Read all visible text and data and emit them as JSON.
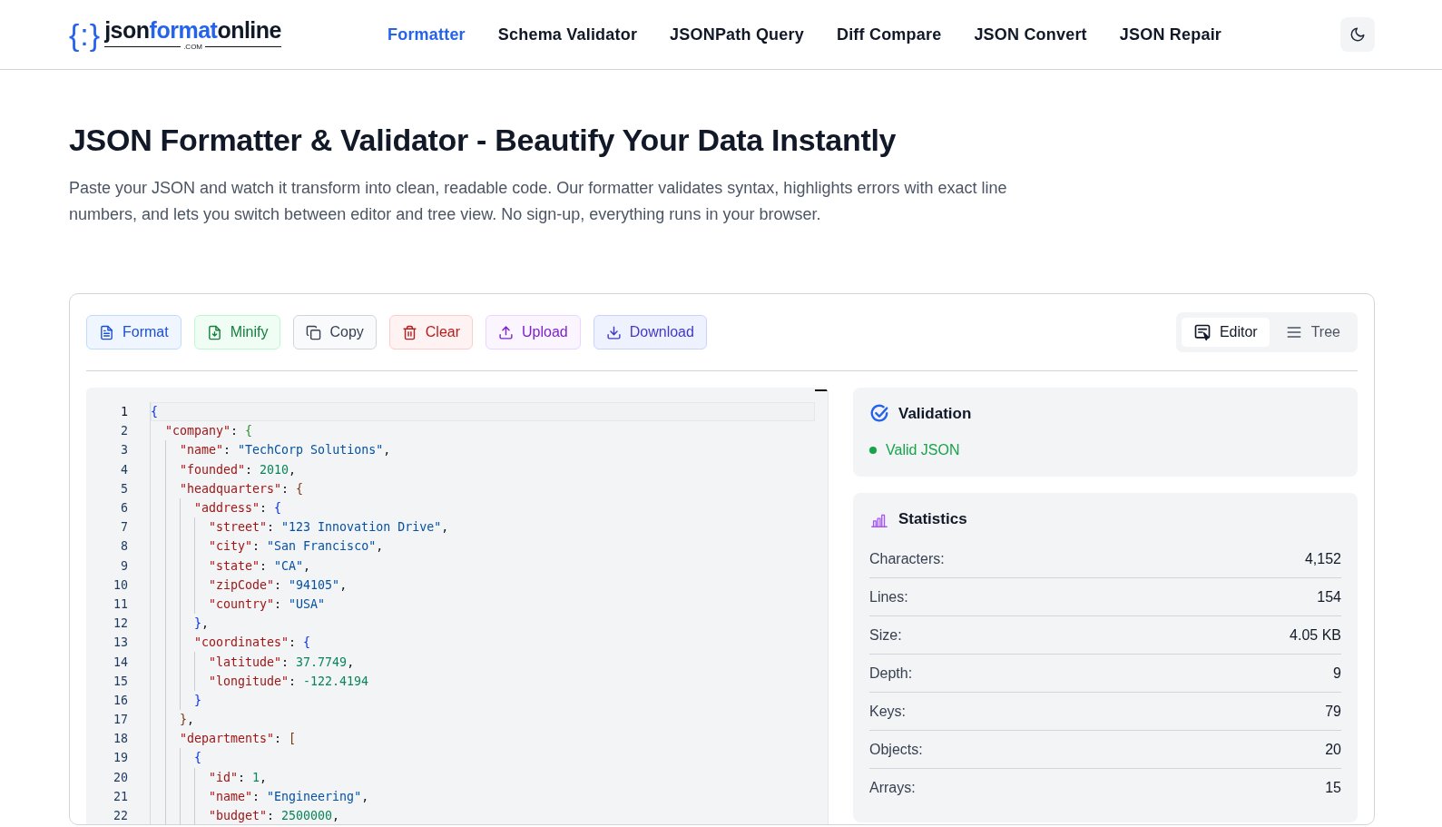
{
  "header": {
    "logo": {
      "mark": "{:}",
      "parts": [
        {
          "text": "json",
          "accent": false
        },
        {
          "text": "format",
          "accent": true
        },
        {
          "text": "online",
          "accent": false
        }
      ],
      "domain": ".COM"
    },
    "nav": [
      {
        "label": "Formatter",
        "selected": true
      },
      {
        "label": "Schema Validator",
        "selected": false
      },
      {
        "label": "JSONPath Query",
        "selected": false
      },
      {
        "label": "Diff Compare",
        "selected": false
      },
      {
        "label": "JSON Convert",
        "selected": false
      },
      {
        "label": "JSON Repair",
        "selected": false
      }
    ]
  },
  "hero": {
    "title": "JSON Formatter & Validator - Beautify Your Data Instantly",
    "description": "Paste your JSON and watch it transform into clean, readable code. Our formatter validates syntax, highlights errors with exact line numbers, and lets you switch between editor and tree view. No sign-up, everything runs in your browser."
  },
  "toolbar": {
    "buttons": [
      {
        "label": "Format",
        "kind": "format"
      },
      {
        "label": "Minify",
        "kind": "minify"
      },
      {
        "label": "Copy",
        "kind": "copy"
      },
      {
        "label": "Clear",
        "kind": "clear"
      },
      {
        "label": "Upload",
        "kind": "upload"
      },
      {
        "label": "Download",
        "kind": "download"
      }
    ],
    "views": [
      {
        "label": "Editor",
        "kind": "editor",
        "selected": true
      },
      {
        "label": "Tree",
        "kind": "tree",
        "selected": false
      }
    ]
  },
  "editor": {
    "lines": [
      {
        "number": "1",
        "active": true,
        "tokens": [
          {
            "text": "{",
            "kind": "brace0"
          }
        ]
      },
      {
        "number": "2",
        "active": false,
        "tokens": [
          {
            "text": "  \"company\"",
            "kind": "key"
          },
          {
            "text": ": ",
            "kind": "punct"
          },
          {
            "text": "{",
            "kind": "brace1"
          }
        ]
      },
      {
        "number": "3",
        "active": false,
        "tokens": [
          {
            "text": "    \"name\"",
            "kind": "key"
          },
          {
            "text": ": ",
            "kind": "punct"
          },
          {
            "text": "\"TechCorp Solutions\"",
            "kind": "string"
          },
          {
            "text": ",",
            "kind": "punct"
          }
        ]
      },
      {
        "number": "4",
        "active": false,
        "tokens": [
          {
            "text": "    \"founded\"",
            "kind": "key"
          },
          {
            "text": ": ",
            "kind": "punct"
          },
          {
            "text": "2010",
            "kind": "number"
          },
          {
            "text": ",",
            "kind": "punct"
          }
        ]
      },
      {
        "number": "5",
        "active": false,
        "tokens": [
          {
            "text": "    \"headquarters\"",
            "kind": "key"
          },
          {
            "text": ": ",
            "kind": "punct"
          },
          {
            "text": "{",
            "kind": "brace2"
          }
        ]
      },
      {
        "number": "6",
        "active": false,
        "tokens": [
          {
            "text": "      \"address\"",
            "kind": "key"
          },
          {
            "text": ": ",
            "kind": "punct"
          },
          {
            "text": "{",
            "kind": "brace0"
          }
        ]
      },
      {
        "number": "7",
        "active": false,
        "tokens": [
          {
            "text": "        \"street\"",
            "kind": "key"
          },
          {
            "text": ": ",
            "kind": "punct"
          },
          {
            "text": "\"123 Innovation Drive\"",
            "kind": "string"
          },
          {
            "text": ",",
            "kind": "punct"
          }
        ]
      },
      {
        "number": "8",
        "active": false,
        "tokens": [
          {
            "text": "        \"city\"",
            "kind": "key"
          },
          {
            "text": ": ",
            "kind": "punct"
          },
          {
            "text": "\"San Francisco\"",
            "kind": "string"
          },
          {
            "text": ",",
            "kind": "punct"
          }
        ]
      },
      {
        "number": "9",
        "active": false,
        "tokens": [
          {
            "text": "        \"state\"",
            "kind": "key"
          },
          {
            "text": ": ",
            "kind": "punct"
          },
          {
            "text": "\"CA\"",
            "kind": "string"
          },
          {
            "text": ",",
            "kind": "punct"
          }
        ]
      },
      {
        "number": "10",
        "active": false,
        "tokens": [
          {
            "text": "        \"zipCode\"",
            "kind": "key"
          },
          {
            "text": ": ",
            "kind": "punct"
          },
          {
            "text": "\"94105\"",
            "kind": "string"
          },
          {
            "text": ",",
            "kind": "punct"
          }
        ]
      },
      {
        "number": "11",
        "active": false,
        "tokens": [
          {
            "text": "        \"country\"",
            "kind": "key"
          },
          {
            "text": ": ",
            "kind": "punct"
          },
          {
            "text": "\"USA\"",
            "kind": "string"
          }
        ]
      },
      {
        "number": "12",
        "active": false,
        "tokens": [
          {
            "text": "      }",
            "kind": "brace0"
          },
          {
            "text": ",",
            "kind": "punct"
          }
        ]
      },
      {
        "number": "13",
        "active": false,
        "tokens": [
          {
            "text": "      \"coordinates\"",
            "kind": "key"
          },
          {
            "text": ": ",
            "kind": "punct"
          },
          {
            "text": "{",
            "kind": "brace0"
          }
        ]
      },
      {
        "number": "14",
        "active": false,
        "tokens": [
          {
            "text": "        \"latitude\"",
            "kind": "key"
          },
          {
            "text": ": ",
            "kind": "punct"
          },
          {
            "text": "37.7749",
            "kind": "number"
          },
          {
            "text": ",",
            "kind": "punct"
          }
        ]
      },
      {
        "number": "15",
        "active": false,
        "tokens": [
          {
            "text": "        \"longitude\"",
            "kind": "key"
          },
          {
            "text": ": ",
            "kind": "punct"
          },
          {
            "text": "-122.4194",
            "kind": "number"
          }
        ]
      },
      {
        "number": "16",
        "active": false,
        "tokens": [
          {
            "text": "      }",
            "kind": "brace0"
          }
        ]
      },
      {
        "number": "17",
        "active": false,
        "tokens": [
          {
            "text": "    }",
            "kind": "brace2"
          },
          {
            "text": ",",
            "kind": "punct"
          }
        ]
      },
      {
        "number": "18",
        "active": false,
        "tokens": [
          {
            "text": "    \"departments\"",
            "kind": "key"
          },
          {
            "text": ": ",
            "kind": "punct"
          },
          {
            "text": "[",
            "kind": "brace2"
          }
        ]
      },
      {
        "number": "19",
        "active": false,
        "tokens": [
          {
            "text": "      {",
            "kind": "brace0"
          }
        ]
      },
      {
        "number": "20",
        "active": false,
        "tokens": [
          {
            "text": "        \"id\"",
            "kind": "key"
          },
          {
            "text": ": ",
            "kind": "punct"
          },
          {
            "text": "1",
            "kind": "number"
          },
          {
            "text": ",",
            "kind": "punct"
          }
        ]
      },
      {
        "number": "21",
        "active": false,
        "tokens": [
          {
            "text": "        \"name\"",
            "kind": "key"
          },
          {
            "text": ": ",
            "kind": "punct"
          },
          {
            "text": "\"Engineering\"",
            "kind": "string"
          },
          {
            "text": ",",
            "kind": "punct"
          }
        ]
      },
      {
        "number": "22",
        "active": false,
        "tokens": [
          {
            "text": "        \"budget\"",
            "kind": "key"
          },
          {
            "text": ": ",
            "kind": "punct"
          },
          {
            "text": "2500000",
            "kind": "number"
          },
          {
            "text": ",",
            "kind": "punct"
          }
        ]
      }
    ]
  },
  "validation": {
    "title": "Validation",
    "status": "Valid JSON",
    "valid": true
  },
  "statistics": {
    "title": "Statistics",
    "rows": [
      {
        "label": "Characters:",
        "value": "4,152"
      },
      {
        "label": "Lines:",
        "value": "154"
      },
      {
        "label": "Size:",
        "value": "4.05 KB"
      },
      {
        "label": "Depth:",
        "value": "9"
      },
      {
        "label": "Keys:",
        "value": "79"
      },
      {
        "label": "Objects:",
        "value": "20"
      },
      {
        "label": "Arrays:",
        "value": "15"
      }
    ]
  }
}
